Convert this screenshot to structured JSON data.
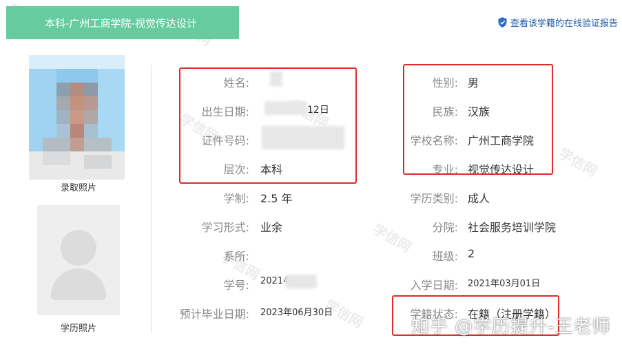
{
  "header": {
    "title": "本科-广州工商学院-视觉传达设计",
    "verify_link": "查看该学籍的在线验证报告",
    "accent_color": "#67cba0",
    "link_color": "#1e5aa8"
  },
  "photos": {
    "admission_label": "录取照片",
    "diploma_label": "学历照片"
  },
  "left_fields": [
    {
      "label": "姓名:",
      "value": ""
    },
    {
      "label": "出生日期:",
      "value": "12日"
    },
    {
      "label": "证件号码:",
      "value": ""
    },
    {
      "label": "层次:",
      "value": "本科"
    },
    {
      "label": "学制:",
      "value": "2.5 年"
    },
    {
      "label": "学习形式:",
      "value": "业余"
    },
    {
      "label": "系所:",
      "value": ""
    },
    {
      "label": "学号:",
      "value": "20214"
    },
    {
      "label": "预计毕业日期:",
      "value": "2023年06月30日"
    }
  ],
  "right_fields": [
    {
      "label": "性别:",
      "value": "男"
    },
    {
      "label": "民族:",
      "value": "汉族"
    },
    {
      "label": "学校名称:",
      "value": "广州工商学院"
    },
    {
      "label": "专业:",
      "value": "视觉传达设计"
    },
    {
      "label": "学历类别:",
      "value": "成人"
    },
    {
      "label": "分院:",
      "value": "社会服务培训学院"
    },
    {
      "label": "班级:",
      "value": "2"
    },
    {
      "label": "入学日期:",
      "value": "2021年03月01日"
    },
    {
      "label": "学籍状态:",
      "value": "在籍（注册学籍）"
    }
  ],
  "watermark": {
    "background_text": "学信网",
    "bottom_text": "知乎 @学历提升-王老师"
  },
  "highlight_color": "#e02b2b"
}
